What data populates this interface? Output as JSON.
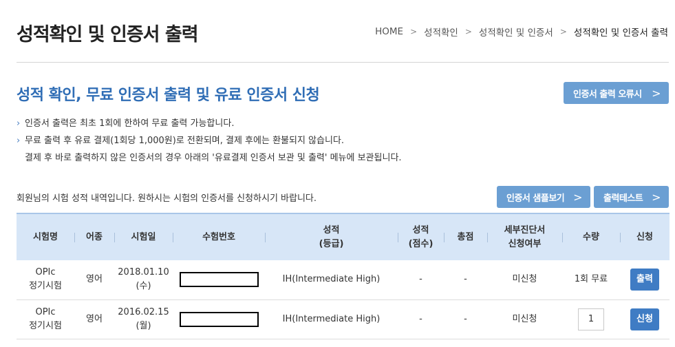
{
  "page_title": "성적확인 및 인증서 출력",
  "breadcrumb": [
    "HOME",
    "성적확인",
    "성적확인 및 인증서",
    "성적확인 및 인증서 출력"
  ],
  "section_title": "성적 확인, 무료 인증서 출력 및 유료 인증서 신청",
  "buttons": {
    "error_example": "인증서 출력 오류시",
    "sample_view": "인증서 샘플보기",
    "print_test": "출력테스트"
  },
  "notes": [
    "인증서 출력은 최초 1회에 한하여 무료 출력 가능합니다.",
    "무료 출력 후 유료 결제(1회당 1,000원)로 전환되며, 결제 후에는 환불되지 않습니다.",
    "결제 후 바로 출력하지 않은 인증서의 경우 아래의 '유료결제 인증서 보관 및 출력' 메뉴에 보관됩니다."
  ],
  "intro_text": "회원님의 시험 성적 내역입니다. 원하시는 시험의 인증서를 신청하시기 바랍니다.",
  "table": {
    "headers": [
      "시험명",
      "어종",
      "시험일",
      "수험번호",
      "성적\n(등급)",
      "성적\n(점수)",
      "총점",
      "세부진단서\n신청여부",
      "수량",
      "신청"
    ],
    "rows": [
      {
        "exam": "OPIc\n정기시험",
        "language": "영어",
        "date": "2018.01.10\n(수)",
        "grade": "IH(Intermediate High)",
        "score": "-",
        "total": "-",
        "diagnosis": "미신청",
        "quantity": "1회 무료",
        "action": "출력"
      },
      {
        "exam": "OPIc\n정기시험",
        "language": "영어",
        "date": "2016.02.15\n(월)",
        "grade": "IH(Intermediate High)",
        "score": "-",
        "total": "-",
        "diagnosis": "미신청",
        "quantity": "1",
        "action": "신청"
      }
    ]
  },
  "colors": {
    "accent": "#2f6db5",
    "button_light": "#6b9fd3",
    "button_dark": "#3f7cc4",
    "table_header_bg": "#d7e6f7"
  }
}
